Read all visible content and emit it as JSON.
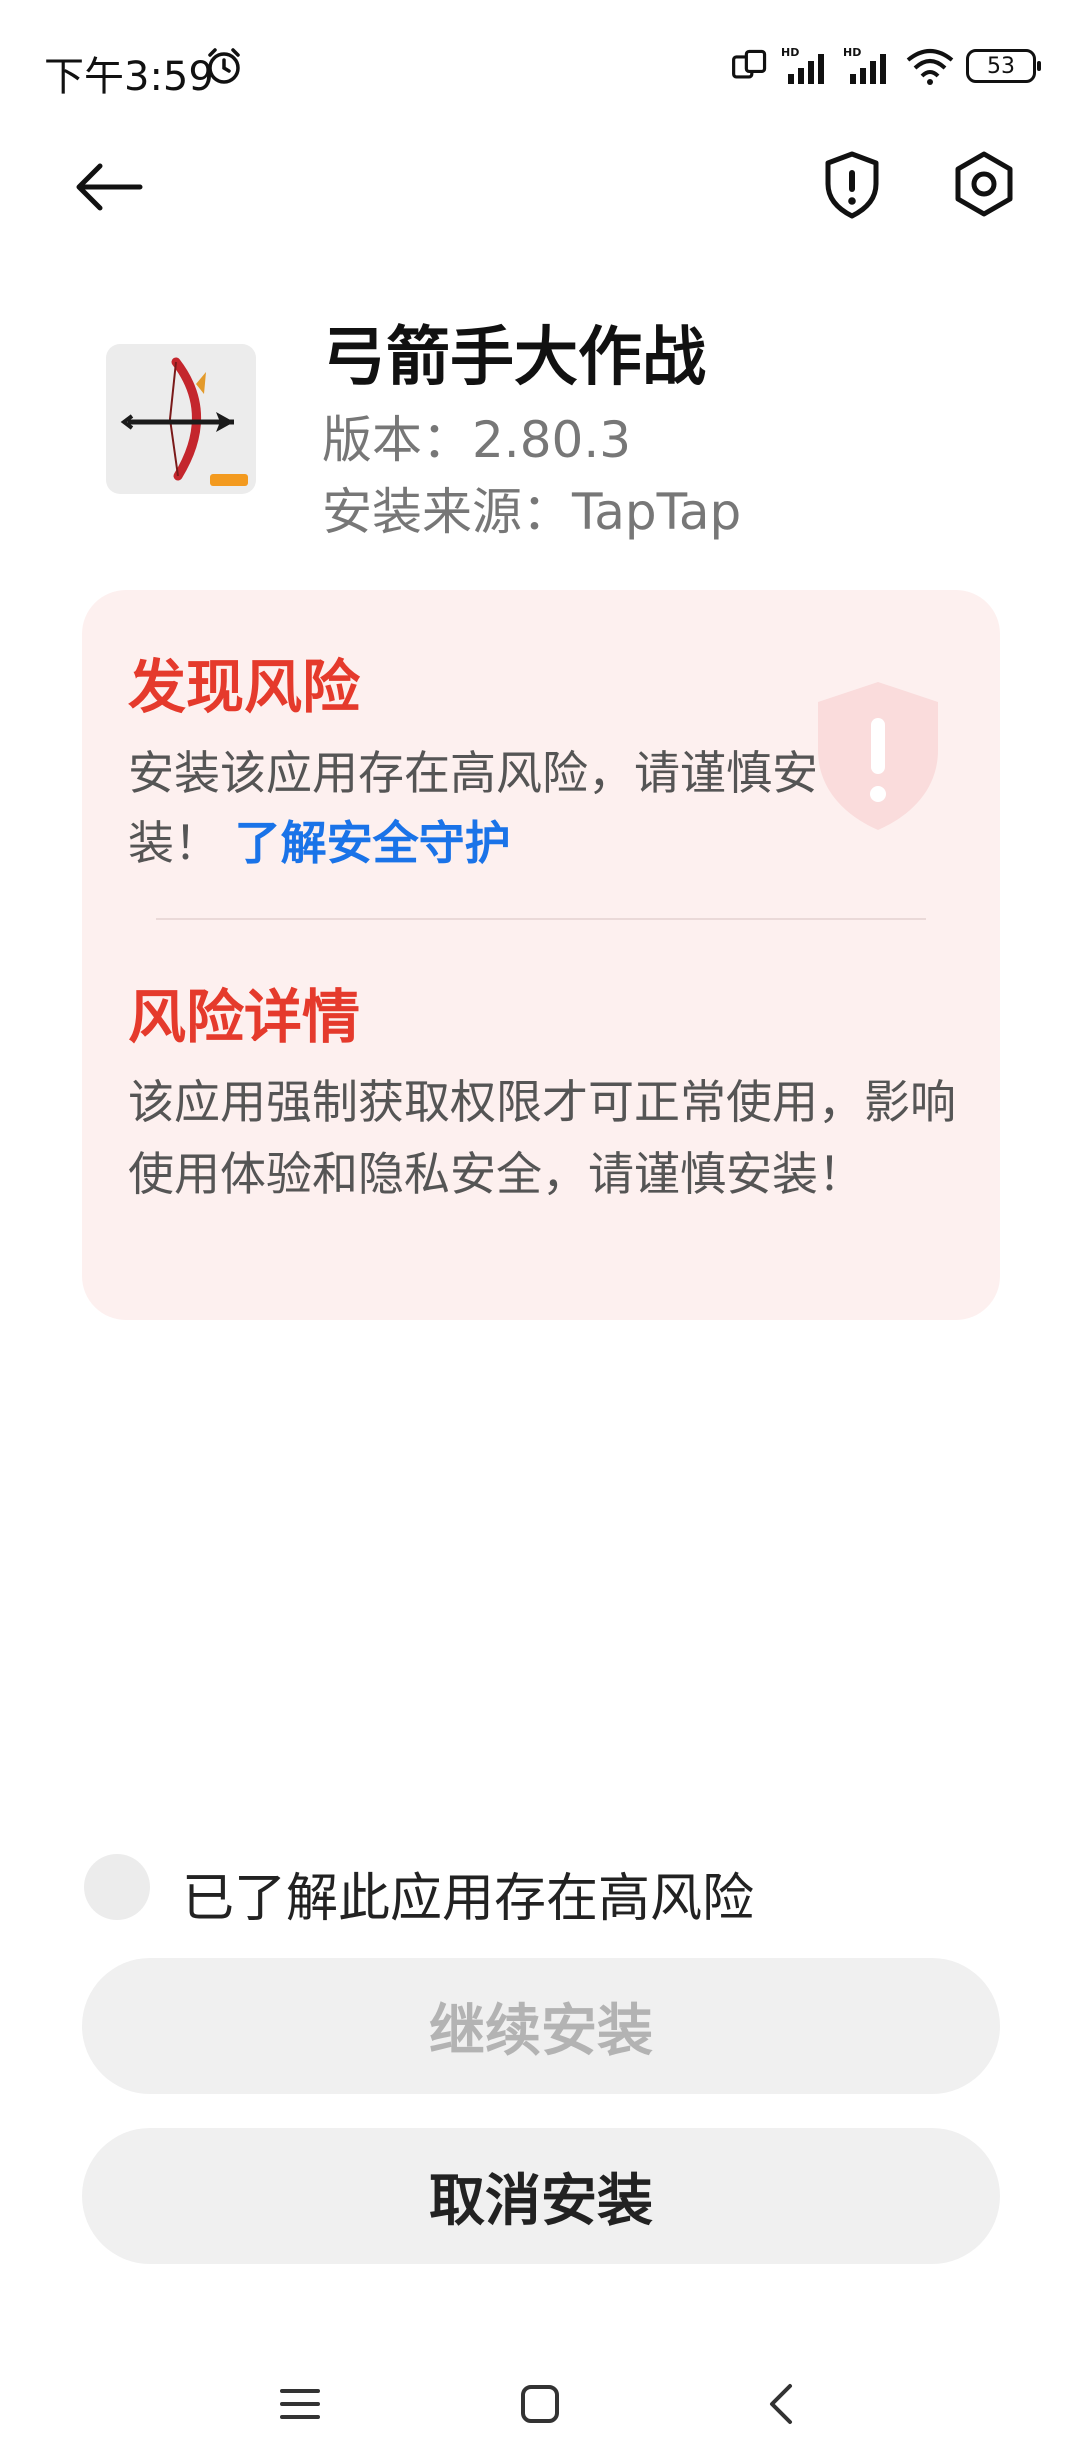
{
  "status_bar": {
    "time": "下午3:59",
    "battery": "53",
    "icons": [
      "alarm-icon",
      "screen-cast-icon",
      "hd-signal-icon",
      "hd-signal-icon",
      "wifi-icon",
      "battery-icon"
    ]
  },
  "toolbar": {
    "back_icon": "arrow-left-icon",
    "security_icon": "shield-exclamation-icon",
    "settings_icon": "gear-icon"
  },
  "app": {
    "name": "弓箭手大作战",
    "version": "版本：2.80.3",
    "source": "安装来源：TapTap"
  },
  "risk": {
    "title": "发现风险",
    "desc": "安装该应用存在高风险，请谨慎安装！",
    "link": "了解安全守护",
    "detail_title": "风险详情",
    "detail_text": "该应用强制获取权限才可正常使用，影响使用体验和隐私安全，请谨慎安装！"
  },
  "actions": {
    "ack_label": "已了解此应用存在高风险",
    "continue_label": "继续安装",
    "cancel_label": "取消安装"
  },
  "colors": {
    "risk_red": "#e53a2c",
    "link_blue": "#1a73e8",
    "card_bg": "#fdf0ef",
    "button_bg": "#f0f0f0"
  },
  "nav": {
    "icons": [
      "menu-icon",
      "home-square-icon",
      "back-chevron-icon"
    ]
  }
}
